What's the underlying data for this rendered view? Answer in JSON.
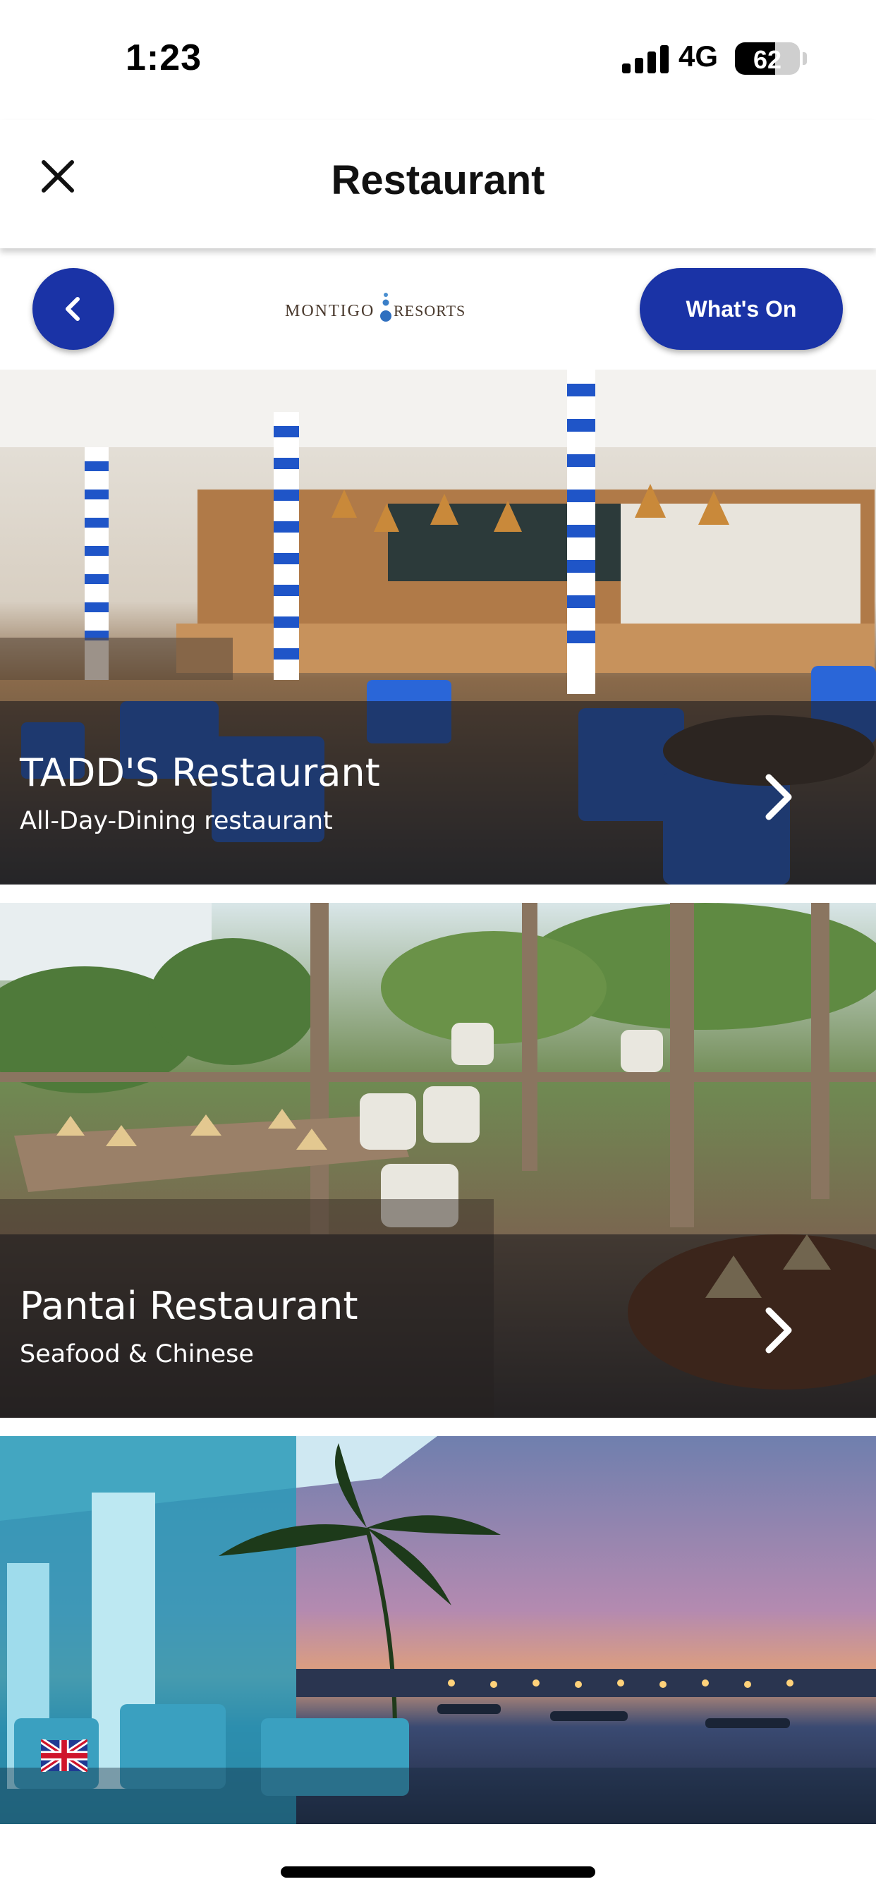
{
  "status_bar": {
    "time": "1:23",
    "network": "4G",
    "battery_level": "62"
  },
  "header": {
    "title": "Restaurant",
    "close_icon": "close-icon"
  },
  "top_bar": {
    "back_icon": "chevron-left-icon",
    "logo_text_left": "MONTIGO",
    "logo_text_right": "RESORTS",
    "whats_on_label": "What's On",
    "accent_color": "#1a33a6"
  },
  "restaurants": [
    {
      "name": "TADD'S Restaurant",
      "subtitle": "All-Day-Dining restaurant",
      "icon": "chevron-right-icon"
    },
    {
      "name": "Pantai Restaurant",
      "subtitle": "Seafood & Chinese",
      "icon": "chevron-right-icon"
    },
    {
      "name": "",
      "subtitle": "",
      "icon": ""
    }
  ],
  "language": {
    "flag_icon": "uk-flag-icon"
  }
}
